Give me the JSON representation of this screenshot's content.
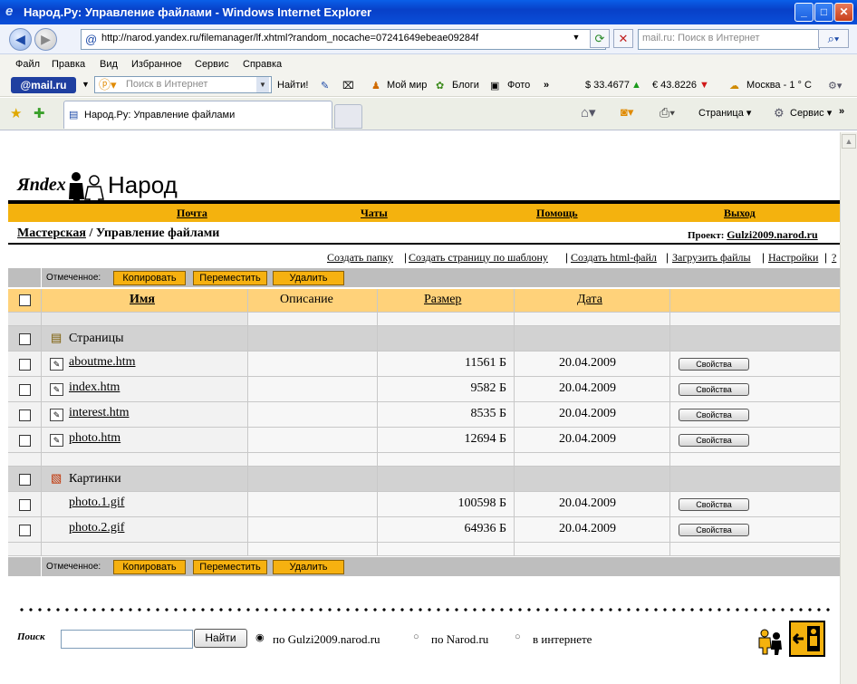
{
  "window": {
    "title": "Народ.Ру: Управление файлами - Windows Internet Explorer"
  },
  "address": {
    "url": "http://narod.yandex.ru/filemanager/lf.xhtml?random_nocache=07241649ebeae09284f",
    "search_placeholder": "mail.ru: Поиск в Интернет"
  },
  "menu": [
    "Файл",
    "Правка",
    "Вид",
    "Избранное",
    "Сервис",
    "Справка"
  ],
  "toolbar": {
    "mail_logo": "@mail.ru",
    "search_placeholder": "Поиск в Интернет",
    "find_label": "Найти!",
    "moy_mir": "Мой мир",
    "blogi": "Блоги",
    "foto": "Фото",
    "usd": "$ 33.4677",
    "eur": "€ 43.8226",
    "weather": "Москва - 1 ° C"
  },
  "tabs": {
    "active": "Народ.Ру: Управление файлами",
    "page_menu": "Страница",
    "service_menu": "Сервис"
  },
  "page": {
    "logo_left": "Яndex",
    "logo_right": "Народ",
    "nav": [
      "Почта",
      "Чаты",
      "Помощь",
      "Выход"
    ],
    "breadcrumb_link": "Мастерская",
    "breadcrumb_current": " / Управление файлами",
    "project_label": "Проект:",
    "project_name": "Gulzi2009.narod.ru",
    "actions": [
      "Создать папку",
      "Создать страницу по шаблону",
      "Создать html-файл",
      "Загрузить файлы",
      "Настройки",
      "?"
    ],
    "marked_label": "Отмеченное:",
    "copy": "Копировать",
    "move": "Переместить",
    "delete": "Удалить",
    "columns": {
      "name": "Имя",
      "desc": "Описание",
      "size": "Размер",
      "date": "Дата"
    },
    "groups": [
      {
        "title": "Страницы",
        "files": [
          {
            "name": "aboutme.htm",
            "size": "11561 Б",
            "date": "20.04.2009"
          },
          {
            "name": "index.htm",
            "size": "9582 Б",
            "date": "20.04.2009"
          },
          {
            "name": "interest.htm",
            "size": "8535 Б",
            "date": "20.04.2009"
          },
          {
            "name": "photo.htm",
            "size": "12694 Б",
            "date": "20.04.2009"
          }
        ]
      },
      {
        "title": "Картинки",
        "files": [
          {
            "name": "photo.1.gif",
            "size": "100598 Б",
            "date": "20.04.2009"
          },
          {
            "name": "photo.2.gif",
            "size": "64936 Б",
            "date": "20.04.2009"
          }
        ]
      }
    ],
    "props_label": "Свойства",
    "search": {
      "label": "Поиск",
      "button": "Найти",
      "opt1": "по Gulzi2009.narod.ru",
      "opt2": "по Narod.ru",
      "opt3": "в интернете"
    }
  }
}
